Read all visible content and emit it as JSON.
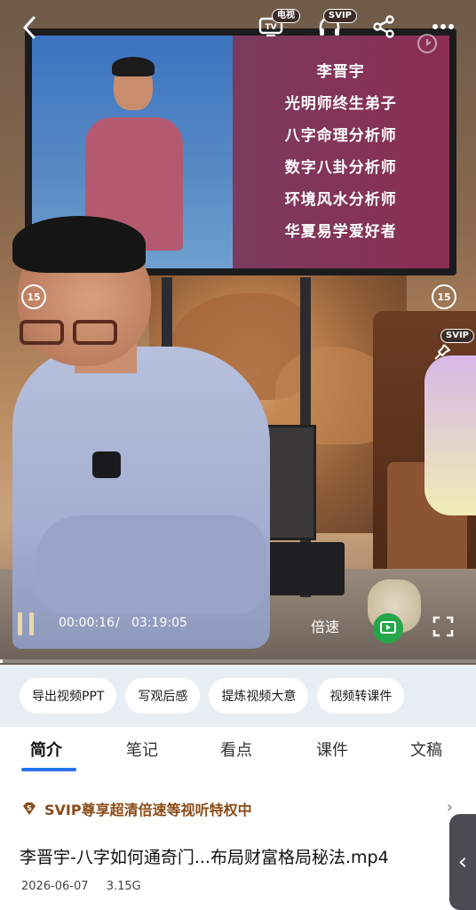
{
  "player": {
    "tv_badge": "电视",
    "svip_badge": "SVIP",
    "svip_badge_side": "SVIP",
    "skip_back_label": "15",
    "skip_forward_label": "15",
    "current_time": "00:00:16",
    "time_separator": "/",
    "duration": "03:19:05",
    "speed_label": "倍速",
    "progress": 0.0013
  },
  "slide": {
    "lines": [
      "李晋宇",
      "光明师终生弟子",
      "八字命理分析师",
      "数字八卦分析师",
      "环境风水分析师",
      "华夏易学爱好者"
    ]
  },
  "tools": [
    "导出视频PPT",
    "写观后感",
    "提炼视频大意",
    "视频转课件"
  ],
  "tabs": [
    "简介",
    "笔记",
    "看点",
    "课件",
    "文稿"
  ],
  "info": {
    "vip_badge_letter": "S",
    "vip_text": "SVIP尊享超清倍速等视听特权中",
    "filename": "李晋宇-八字如何通奇门...布局财富格局秘法.mp4",
    "date": "2026-06-07",
    "size": "3.15G"
  },
  "colors": {
    "accent": "#2a73f0",
    "vip": "#8a4a17",
    "tools_bg": "#e9eef5"
  }
}
